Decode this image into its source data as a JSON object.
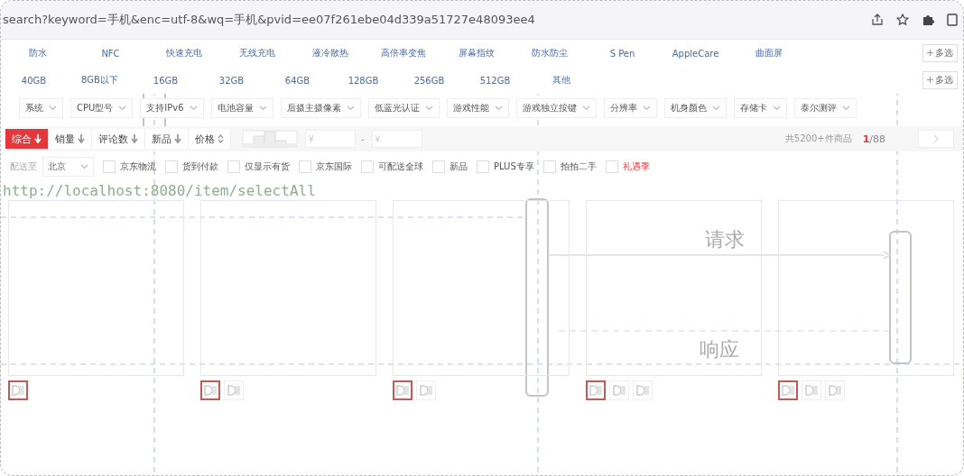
{
  "address_bar": {
    "url": "search?keyword=手机&enc=utf-8&wq=手机&pvid=ee07f261ebe04d339a51727e48093ee4"
  },
  "feature_filters": {
    "items": [
      "防水",
      "NFC",
      "快速充电",
      "无线充电",
      "液冷散热",
      "高倍率变焦",
      "屏幕指纹",
      "防水防尘",
      "S Pen",
      "AppleCare",
      "曲面屏"
    ],
    "more": "多选"
  },
  "storage_filters": {
    "items": [
      "40GB",
      "8GB以下",
      "16GB",
      "32GB",
      "64GB",
      "128GB",
      "256GB",
      "512GB",
      "其他"
    ],
    "more": "多选"
  },
  "dropdown_filters": [
    "系统",
    "CPU型号",
    "支持IPv6",
    "电池容量",
    "后摄主摄像素",
    "低蓝光认证",
    "游戏性能",
    "游戏独立按键",
    "分辨率",
    "机身颜色",
    "存储卡",
    "泰尔测评"
  ],
  "sort_bar": {
    "options": [
      {
        "label": "综合",
        "kind": "desc",
        "selected": true
      },
      {
        "label": "销量",
        "kind": "desc",
        "selected": false
      },
      {
        "label": "评论数",
        "kind": "desc",
        "selected": false
      },
      {
        "label": "新品",
        "kind": "desc",
        "selected": false
      },
      {
        "label": "价格",
        "kind": "both",
        "selected": false
      }
    ],
    "price_min": {
      "placeholder": "¥"
    },
    "price_sep": "-",
    "price_max": {
      "placeholder": "¥"
    },
    "total": "共5200+件商品",
    "page_current": "1",
    "page_total": "/88"
  },
  "options_bar": {
    "ship_label": "配送至",
    "location": "北京",
    "checks": [
      {
        "label": "京东物流",
        "checked": false,
        "highlight": false
      },
      {
        "label": "货到付款",
        "checked": false,
        "highlight": false
      },
      {
        "label": "仅显示有货",
        "checked": false,
        "highlight": false
      },
      {
        "label": "京东国际",
        "checked": false,
        "highlight": false
      },
      {
        "label": "可配送全球",
        "checked": false,
        "highlight": false
      },
      {
        "label": "新品",
        "checked": false,
        "highlight": false
      },
      {
        "label": "PLUS专享",
        "checked": false,
        "highlight": false
      },
      {
        "label": "拍拍二手",
        "checked": false,
        "highlight": false
      },
      {
        "label": "礼遇季",
        "checked": false,
        "highlight": true
      }
    ]
  },
  "overlay": {
    "url": "http://localhost:8080/item/selectAll",
    "request": "请求",
    "response": "响应"
  },
  "products": [
    {
      "thumbs": [
        {
          "selected": true
        }
      ]
    },
    {
      "thumbs": [
        {
          "selected": true
        },
        {
          "selected": false
        }
      ]
    },
    {
      "thumbs": [
        {
          "selected": true
        },
        {
          "selected": false
        }
      ]
    },
    {
      "thumbs": [
        {
          "selected": true
        },
        {
          "selected": false
        },
        {
          "selected": false
        }
      ]
    },
    {
      "thumbs": [
        {
          "selected": true
        },
        {
          "selected": false
        },
        {
          "selected": false
        }
      ]
    }
  ]
}
